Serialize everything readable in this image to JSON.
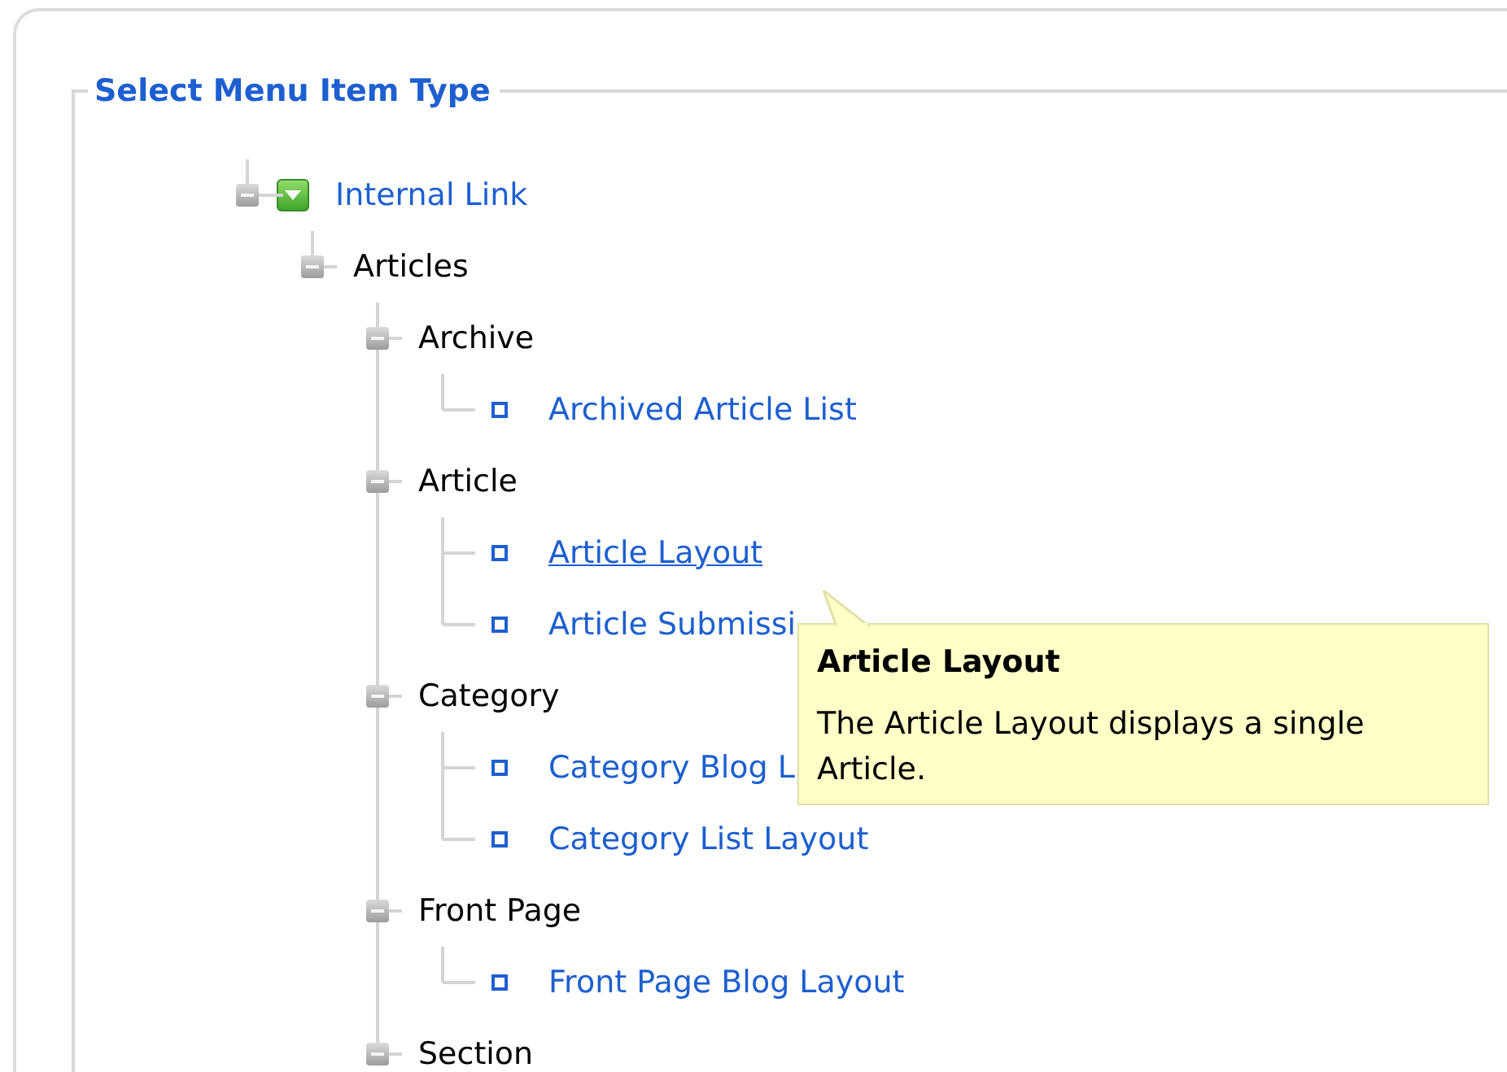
{
  "legend": "Select Menu Item Type",
  "tree": [
    {
      "label": "Internal Link",
      "kind": "type",
      "expanded": true,
      "children": [
        {
          "label": "Articles",
          "kind": "folder",
          "expanded": true,
          "children": [
            {
              "label": "Archive",
              "kind": "folder",
              "expanded": true,
              "children": [
                {
                  "label": "Archived Article List",
                  "kind": "item",
                  "hovered": false
                }
              ]
            },
            {
              "label": "Article",
              "kind": "folder",
              "expanded": true,
              "children": [
                {
                  "label": "Article Layout",
                  "kind": "item",
                  "hovered": true
                },
                {
                  "label": "Article Submissi",
                  "kind": "item",
                  "hovered": false
                }
              ]
            },
            {
              "label": "Category",
              "kind": "folder",
              "expanded": true,
              "children": [
                {
                  "label": "Category Blog L",
                  "kind": "item",
                  "hovered": false
                },
                {
                  "label": "Category List Layout",
                  "kind": "item",
                  "hovered": false
                }
              ]
            },
            {
              "label": "Front Page",
              "kind": "folder",
              "expanded": true,
              "children": [
                {
                  "label": "Front Page Blog Layout",
                  "kind": "item",
                  "hovered": false
                }
              ]
            },
            {
              "label": "Section",
              "kind": "folder",
              "expanded": true
            }
          ]
        }
      ]
    }
  ],
  "tooltip": {
    "title": "Article Layout",
    "text": "The Article Layout displays a single Article."
  }
}
